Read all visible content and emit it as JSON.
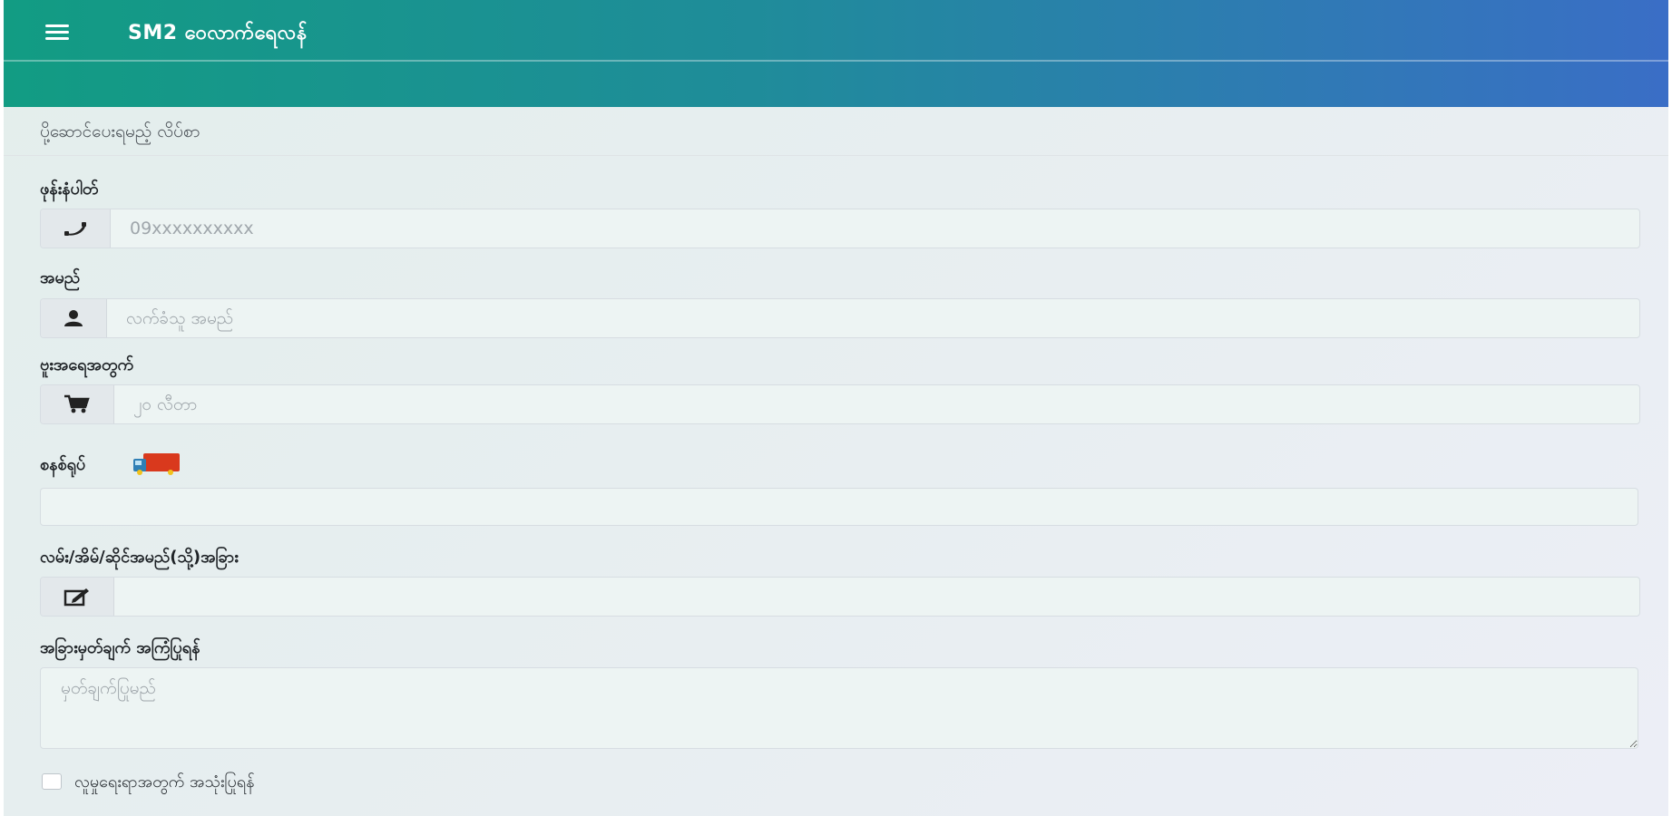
{
  "header": {
    "title": "SM2 ဝေလာက်ရေလန်",
    "menu_icon": "hamburger-menu-icon",
    "gradient_start": "#129c83",
    "gradient_end": "#3a6ec6"
  },
  "card": {
    "title": "ပို့ဆောင်ပေးရမည့် လိပ်စာ"
  },
  "form": {
    "phone": {
      "label": "ဖုန်းနံပါတ်",
      "placeholder": "09xxxxxxxxxx",
      "value": "",
      "icon": "phone-icon"
    },
    "name": {
      "label": "အမည်",
      "placeholder": "လက်ခံသူ အမည်",
      "value": "",
      "icon": "user-icon"
    },
    "quantity": {
      "label": "ဗူးအရေအတွက်",
      "placeholder": "၂၀ လီတာ",
      "value": "",
      "icon": "shopping-cart-icon"
    },
    "delivery": {
      "label": "စနစ်ရုပ်",
      "value": "",
      "icon": "delivery-truck-icon"
    },
    "address": {
      "label": "လမ်း/အိမ်/ဆိုင်အမည်(သို့)အခြား",
      "value": "",
      "icon": "edit-note-icon"
    },
    "notes": {
      "label": "အခြားမှတ်ချက် အကြံပြုရန်",
      "placeholder": "မှတ်ချက်ပြုမည်",
      "value": ""
    },
    "remember": {
      "label": "လူမှုရေးရာအတွက် အသုံးပြုရန်",
      "checked": false
    }
  }
}
